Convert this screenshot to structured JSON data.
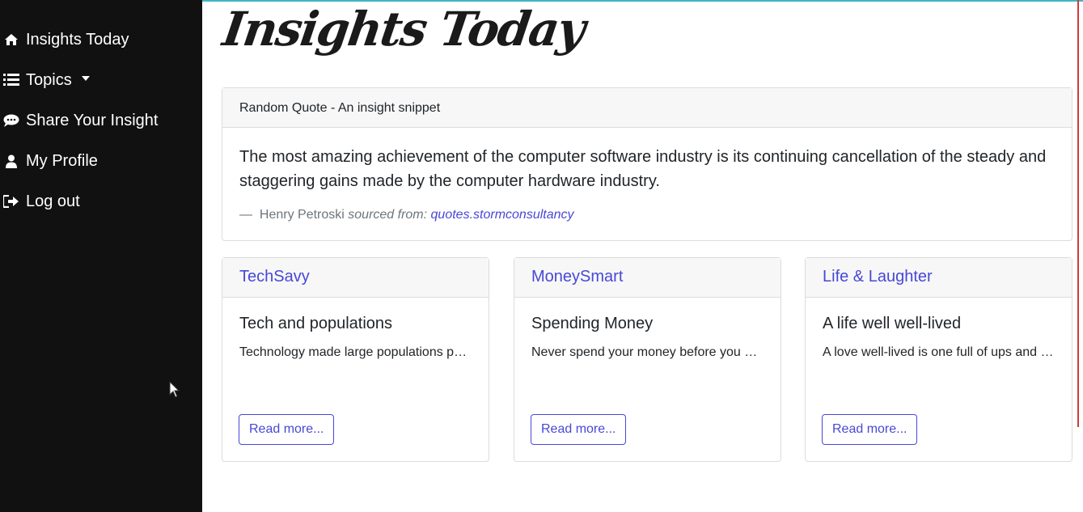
{
  "sidebar": {
    "items": [
      {
        "label": "Insights Today",
        "icon": "home-icon"
      },
      {
        "label": "Topics",
        "icon": "list-icon"
      },
      {
        "label": "Share Your Insight",
        "icon": "comment-icon"
      },
      {
        "label": "My Profile",
        "icon": "user-icon"
      },
      {
        "label": "Log out",
        "icon": "sign-out-icon"
      }
    ]
  },
  "main": {
    "title": "Insights Today",
    "quote": {
      "header": "Random Quote - An insight snippet",
      "text": "The most amazing achievement of the computer software industry is its continuing cancellation of the steady and staggering gains made by the computer hardware industry.",
      "dash": "—",
      "author": "Henry Petroski",
      "source_label": "sourced from:",
      "source_link": "quotes.stormconsultancy"
    },
    "topics": [
      {
        "name": "TechSavy",
        "title": "Tech and populations",
        "excerpt": "Technology made large populations possible",
        "button": "Read more..."
      },
      {
        "name": "MoneySmart",
        "title": "Spending Money",
        "excerpt": "Never spend your money before you have it",
        "button": "Read more..."
      },
      {
        "name": "Life & Laughter",
        "title": "A life well well-lived",
        "excerpt": "A love well-lived is one full of ups and downs",
        "button": "Read more..."
      }
    ]
  },
  "colors": {
    "sidebar_bg": "#111111",
    "link": "#4848d6",
    "card_header_bg": "#f7f7f7"
  }
}
